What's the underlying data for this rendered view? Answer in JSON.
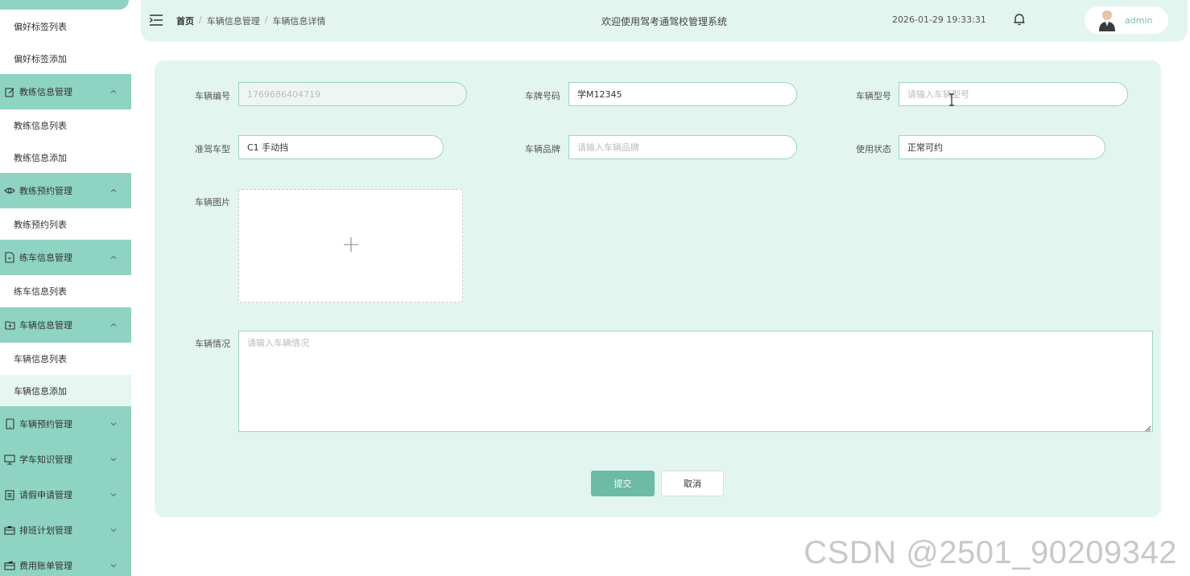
{
  "sidebar": {
    "items": [
      {
        "type": "sub",
        "label": "偏好标签列表"
      },
      {
        "type": "sub",
        "label": "偏好标签添加"
      },
      {
        "type": "group",
        "label": "教练信息管理",
        "icon": "edit-icon",
        "expanded": true
      },
      {
        "type": "sub",
        "label": "教练信息列表"
      },
      {
        "type": "sub",
        "label": "教练信息添加"
      },
      {
        "type": "group",
        "label": "教练预约管理",
        "icon": "eye-icon",
        "expanded": true
      },
      {
        "type": "sub",
        "label": "教练预约列表"
      },
      {
        "type": "group",
        "label": "练车信息管理",
        "icon": "document-icon",
        "expanded": true
      },
      {
        "type": "sub",
        "label": "练车信息列表"
      },
      {
        "type": "group",
        "label": "车辆信息管理",
        "icon": "folder-icon",
        "expanded": true
      },
      {
        "type": "sub",
        "label": "车辆信息列表"
      },
      {
        "type": "sub",
        "label": "车辆信息添加",
        "active": true
      },
      {
        "type": "group",
        "label": "车辆预约管理",
        "icon": "phone-icon",
        "expanded": false
      },
      {
        "type": "group",
        "label": "学车知识管理",
        "icon": "monitor-icon",
        "expanded": false
      },
      {
        "type": "group",
        "label": "请假申请管理",
        "icon": "list-icon",
        "expanded": false
      },
      {
        "type": "group",
        "label": "排班计划管理",
        "icon": "briefcase-icon",
        "expanded": false
      },
      {
        "type": "group",
        "label": "费用账单管理",
        "icon": "wallet-icon",
        "expanded": false
      }
    ]
  },
  "header": {
    "breadcrumb": [
      "首页",
      "车辆信息管理",
      "车辆信息详情"
    ],
    "separator": "/",
    "welcome": "欢迎使用驾考通驾校管理系统",
    "datetime": "2026-01-29 19:33:31",
    "username": "admin"
  },
  "form": {
    "vehicle_no": {
      "label": "车辆编号",
      "value": "1769686404719"
    },
    "plate_no": {
      "label": "车牌号码",
      "value": "学M12345"
    },
    "model": {
      "label": "车辆型号",
      "placeholder": "请输入车辆型号"
    },
    "license_type": {
      "label": "准驾车型",
      "value": "C1 手动挡"
    },
    "brand": {
      "label": "车辆品牌",
      "placeholder": "请输入车辆品牌"
    },
    "status": {
      "label": "使用状态",
      "value": "正常可约"
    },
    "image": {
      "label": "车辆图片",
      "upload_symbol": "+"
    },
    "condition": {
      "label": "车辆情况",
      "placeholder": "请输入车辆情况"
    },
    "submit_label": "提交",
    "cancel_label": "取消"
  },
  "watermark": "CSDN @2501_90209342",
  "colors": {
    "sidebar_group": "#8fd4c2",
    "panel": "#e3f5ef",
    "accent": "#6cbba4",
    "input_border": "#9dd4c2"
  }
}
